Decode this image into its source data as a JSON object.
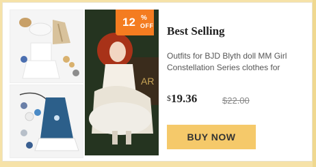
{
  "badge": {
    "number": "12",
    "percent": "%",
    "off": "OFF"
  },
  "product": {
    "title": "Best Selling",
    "description_line1": "Outfits for BJD Blyth doll MM Girl",
    "description_line2": "Constellation Series clothes for",
    "currency": "$",
    "price": "19.36",
    "old_price": "$22.00",
    "buy_label": "BUY NOW"
  },
  "colors": {
    "background": "#f6e2a8",
    "badge": "#f47c20",
    "button": "#f5c96a"
  }
}
